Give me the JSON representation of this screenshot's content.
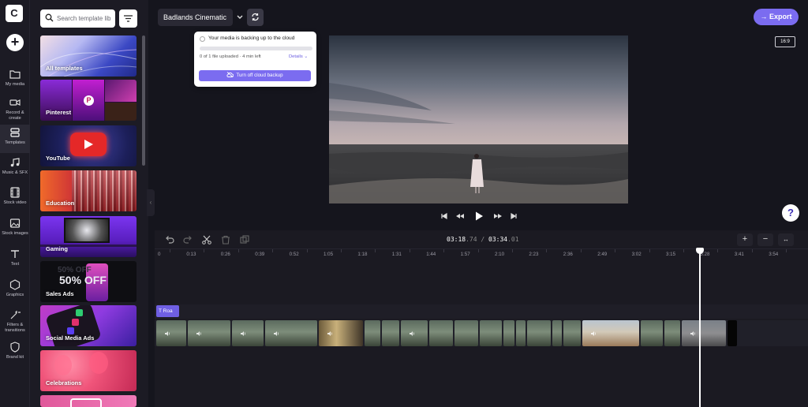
{
  "app": {
    "logo_letter": "C"
  },
  "rail": {
    "items": [
      {
        "label": "My media",
        "icon": "folder-icon"
      },
      {
        "label": "Record & create",
        "icon": "camera-icon"
      },
      {
        "label": "Templates",
        "icon": "templates-icon"
      },
      {
        "label": "Music & SFX",
        "icon": "music-icon"
      },
      {
        "label": "Stock video",
        "icon": "film-icon"
      },
      {
        "label": "Stock images",
        "icon": "image-icon"
      },
      {
        "label": "Text",
        "icon": "text-icon"
      },
      {
        "label": "Graphics",
        "icon": "shapes-icon"
      },
      {
        "label": "Filters & transitions",
        "icon": "magic-icon"
      },
      {
        "label": "Brand kit",
        "icon": "shield-icon"
      }
    ],
    "active": "Templates"
  },
  "panel": {
    "search_placeholder": "Search template lib",
    "tiles": [
      {
        "label": "All templates"
      },
      {
        "label": "Pinterest"
      },
      {
        "label": "YouTube"
      },
      {
        "label": "Education"
      },
      {
        "label": "Gaming"
      },
      {
        "label": "Sales Ads"
      },
      {
        "label": "Social Media Ads"
      },
      {
        "label": "Celebrations"
      }
    ],
    "sale_text": "50% OFF"
  },
  "header": {
    "project_name": "Badlands Cinematic",
    "export_label": "Export",
    "aspect_ratio": "16:9"
  },
  "backup_popup": {
    "message": "Your media is backing up to the cloud",
    "status": "0 of 1 file uploaded · 4 min left",
    "details_label": "Details",
    "button_label": "Turn off cloud backup",
    "progress": 0
  },
  "player": {
    "help_label": "?"
  },
  "timeline": {
    "current_time": "03:18",
    "current_frac": ".74",
    "separator": " / ",
    "total_time": "03:34",
    "total_frac": ".01",
    "ruler_ticks": [
      "0",
      "0:13",
      "0:26",
      "0:39",
      "0:52",
      "1:05",
      "1:18",
      "1:31",
      "1:44",
      "1:57",
      "2:10",
      "2:23",
      "2:36",
      "2:49",
      "3:02",
      "3:15",
      "3:28",
      "3:41",
      "3:54"
    ],
    "text_clip_label": "Roa",
    "zoom_in_label": "+",
    "zoom_out_label": "−",
    "fit_label": "↔"
  },
  "colors": {
    "accent": "#7b6cf0",
    "background": "#15151d",
    "panel": "#1c1b24"
  }
}
